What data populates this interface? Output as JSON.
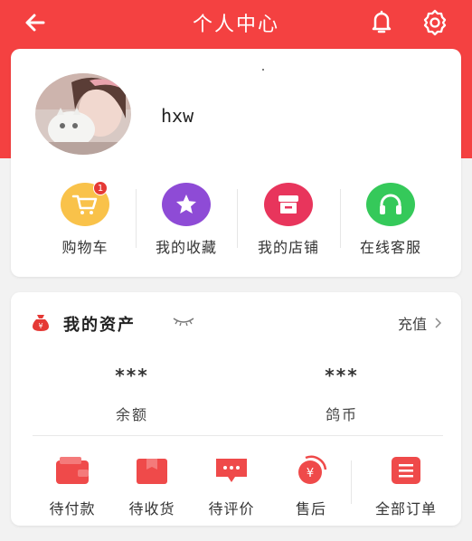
{
  "header": {
    "title": "个人中心",
    "back_icon": "arrow-left-icon",
    "bell_icon": "bell-icon",
    "settings_icon": "gear-icon",
    "bg_color": "#f44141"
  },
  "profile": {
    "username": "hxw"
  },
  "quick_links": [
    {
      "label": "购物车",
      "icon": "cart-icon",
      "color": "#f9c24a",
      "badge": "1"
    },
    {
      "label": "我的收藏",
      "icon": "star-icon",
      "color": "#8e4bd6"
    },
    {
      "label": "我的店铺",
      "icon": "store-icon",
      "color": "#e8355c"
    },
    {
      "label": "在线客服",
      "icon": "headset-icon",
      "color": "#35c95a"
    }
  ],
  "assets": {
    "title": "我的资产",
    "recharge_label": "充值",
    "balance_value": "***",
    "balance_label": "余额",
    "coin_value": "***",
    "coin_label": "鸽币"
  },
  "orders": [
    {
      "label": "待付款",
      "icon": "wallet-icon"
    },
    {
      "label": "待收货",
      "icon": "package-icon"
    },
    {
      "label": "待评价",
      "icon": "comment-icon"
    },
    {
      "label": "售后",
      "icon": "refund-icon"
    },
    {
      "label": "全部订单",
      "icon": "order-list-icon"
    }
  ],
  "colors": {
    "accent": "#f44141",
    "order_icon": "#ef4a4a"
  }
}
